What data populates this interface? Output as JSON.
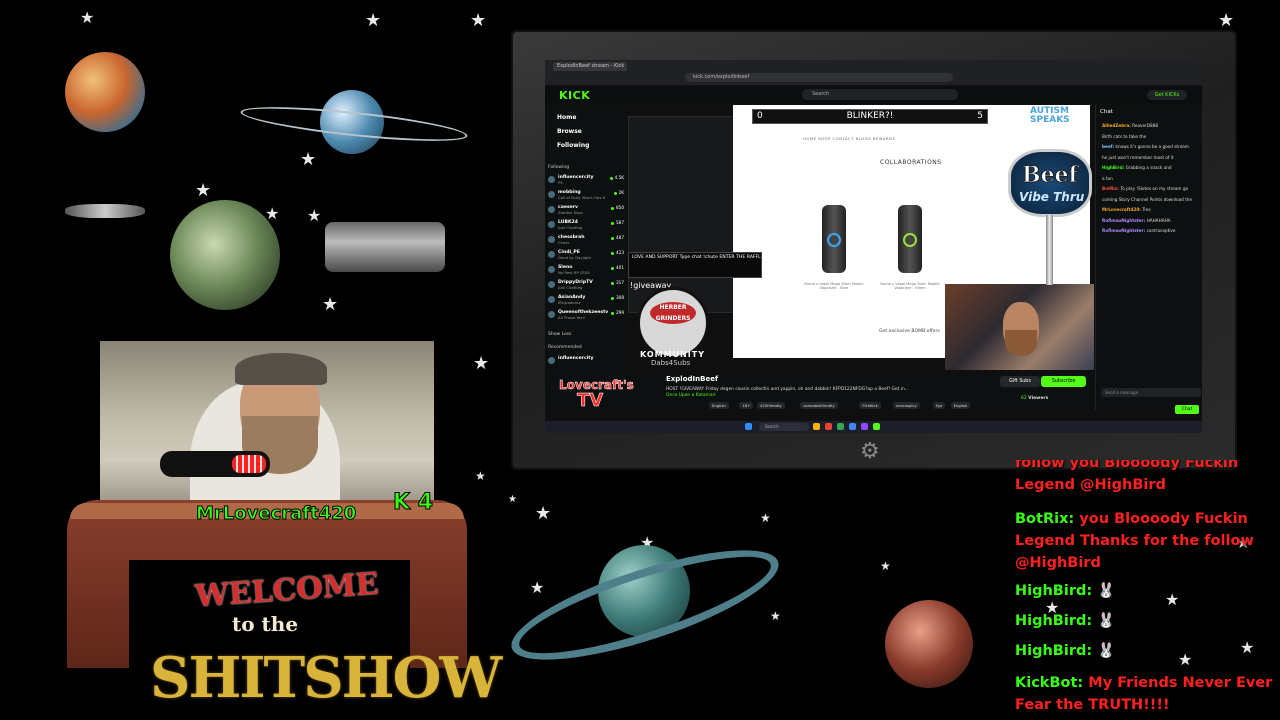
{
  "browser": {
    "tab_title": "ExplodInBeef stream - Kick",
    "url": "kick.com/explodinbeef"
  },
  "kick": {
    "logo": "KICK",
    "search_placeholder": "Search",
    "get_kick": "Get KICKs",
    "nav": [
      "Home",
      "Browse",
      "Following"
    ],
    "following_label": "Following",
    "recommended_label": "Recommended",
    "show_less": "Show Less",
    "following": [
      {
        "name": "influencercity",
        "game": "PS",
        "viewers": "4.5K"
      },
      {
        "name": "mobbing",
        "game": "Call of Duty: Black Ops 6",
        "viewers": "2K"
      },
      {
        "name": "caeserv",
        "game": "Zombie Days",
        "viewers": "850"
      },
      {
        "name": "LUBK24",
        "game": "Just Chatting",
        "viewers": "587"
      },
      {
        "name": "chessbrah",
        "game": "Chess",
        "viewers": "487"
      },
      {
        "name": "Cindi_PE",
        "game": "Dead by Daylight",
        "viewers": "423"
      },
      {
        "name": "Sleno",
        "game": "No Rest RP GTA5",
        "viewers": "401"
      },
      {
        "name": "DrippyDripTV",
        "game": "Just Chatting",
        "viewers": "317"
      },
      {
        "name": "AsianAndy",
        "game": "IRL/podcast",
        "viewers": "308"
      },
      {
        "name": "Queenofthekzeestv",
        "game": "All Those Yes!!",
        "viewers": "299"
      }
    ],
    "recommended_first": "influencercity",
    "chat_title": "Chat",
    "chat_lines": [
      {
        "user": "AlliedZebra:",
        "msg": "ReaverD888",
        "color": "#f5a623"
      },
      {
        "user": "",
        "msg": "Birth cats to take the",
        "color": "#bbbbbb"
      },
      {
        "user": "beef:",
        "msg": "knows it's gonna be a good stream",
        "color": "#7ec8ff"
      },
      {
        "user": "",
        "msg": "he just won't remember most of it",
        "color": "#dddddd"
      },
      {
        "user": "HighBird:",
        "msg": "Grabbing a snack and",
        "color": "#39ff14"
      },
      {
        "user": "",
        "msg": "a ton",
        "color": "#dddddd"
      },
      {
        "user": "BotRix:",
        "msg": "To play !Slotex on my stream go",
        "color": "#ff4d4d"
      },
      {
        "user": "",
        "msg": "coming Story Channel Points download the",
        "color": "#dddddd"
      },
      {
        "user": "MrLovecraft420:",
        "msg": "Tres",
        "color": "#f5a623"
      },
      {
        "user": "RoflmaoNightster:",
        "msg": "HAHAHAHA",
        "color": "#b388ff"
      },
      {
        "user": "RoflmaoNightster:",
        "msg": "contraceptive",
        "color": "#b388ff"
      }
    ],
    "chat_input_placeholder": "Send a message",
    "chat_send": "Chat",
    "streamer": "ExplodInBeef",
    "stream_title": "HOST !GIVEAWAY Friday degen cousin collectin and yappin, oh and dabbin! KFPD122NFDG?ap a Beef! Get in...",
    "category": "Once Upon a Katamari",
    "tags": [
      "English",
      "18+",
      "420friendly",
      "cannabisfriendly",
      "PickKick",
      "neurospicy",
      "fyp",
      "English"
    ],
    "gift_subs": "Gift Subs",
    "subscribe": "Subscribe",
    "viewers": "62",
    "viewers_label": "Viewers",
    "taskbar_search": "Search"
  },
  "video": {
    "banner": "BLINKER?!",
    "banner_left": "0",
    "banner_right": "5",
    "site_nav": "HOME   SHOP   CONTACT   BLOGS   REWARDS",
    "heading": "COLLABORATIONS",
    "products": [
      {
        "name": "Bomb x Vapel Mega Stem Mobile Vaporizer - Blue",
        "accent": "#3da5ff"
      },
      {
        "name": "Bomb x Vapel Mega Stem Mobile Vaporizer - Green",
        "accent": "#9be03a"
      }
    ],
    "exclusive_text": "Get exclusive BOMB offers"
  },
  "overlays": {
    "popup_text": "LOVE AND SUPPORT Type chat !chute ENTER THE RAFFLE PARTNER GRINDER HAPPY THURSDAY JUST WANT TO SEE EVERYONE WI...",
    "giveaway": "!giveaway",
    "badge_text": "HERBER GRINDERS",
    "community": "KOMMUNITY",
    "dabs": "Dabs4Subs",
    "lovecraft_logo_1": "Lovecraft's",
    "lovecraft_logo_2": "TV",
    "autism_text": "AUTISM SPEAKS",
    "beef_sign_1": "Beef",
    "beef_sign_2": "Vibe Thru",
    "username": "MrLovecraft420",
    "k4": "K 4",
    "welcome_1": "WELCOME",
    "welcome_2": "to the",
    "welcome_3": "SHITSHOW"
  },
  "stream_chat": [
    {
      "user": "",
      "msg": "follow you Bloooody Fuckin Legend @HighBird",
      "partial": true
    },
    {
      "user": "BotRix:",
      "msg": "you Bloooody Fuckin Legend Thanks for the follow @HighBird"
    },
    {
      "user": "HighBird:",
      "msg": "🐰"
    },
    {
      "user": "HighBird:",
      "msg": "🐰"
    },
    {
      "user": "HighBird:",
      "msg": "🐰"
    },
    {
      "user": "KickBot:",
      "msg": "My Friends Never Ever Fear the TRUTH!!!!"
    }
  ],
  "icons": {
    "gear": "gear-icon",
    "kick_brand": "#53fc18"
  }
}
